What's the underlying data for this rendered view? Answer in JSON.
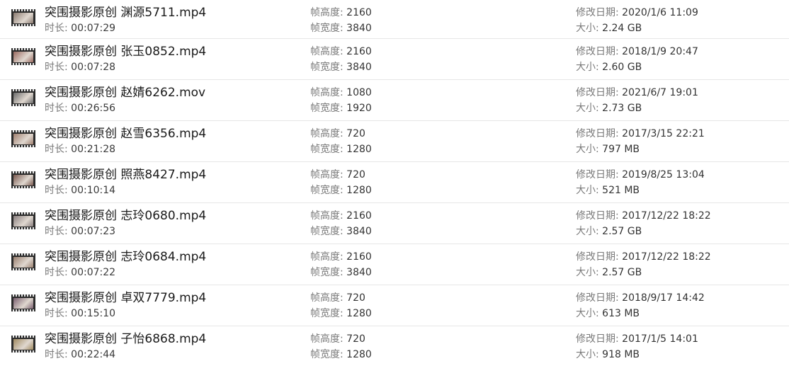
{
  "labels": {
    "duration": "时长:",
    "frame_height": "帧高度:",
    "frame_width": "帧宽度:",
    "modified": "修改日期:",
    "size": "大小:"
  },
  "files": [
    {
      "name": "突围摄影原创 渊源5711.mp4",
      "duration": "00:07:29",
      "frame_height": "2160",
      "frame_width": "3840",
      "modified": "2020/1/6 11:09",
      "size": "2.24 GB",
      "thumb_color": "#8a7a70"
    },
    {
      "name": "突围摄影原创 张玉0852.mp4",
      "duration": "00:07:28",
      "frame_height": "2160",
      "frame_width": "3840",
      "modified": "2018/1/9 20:47",
      "size": "2.60 GB",
      "thumb_color": "#9a6a60"
    },
    {
      "name": "突围摄影原创 赵婧6262.mov",
      "duration": "00:26:56",
      "frame_height": "1080",
      "frame_width": "1920",
      "modified": "2021/6/7 19:01",
      "size": "2.73 GB",
      "thumb_color": "#6a6a6a"
    },
    {
      "name": "突围摄影原创 赵雪6356.mp4",
      "duration": "00:21:28",
      "frame_height": "720",
      "frame_width": "1280",
      "modified": "2017/3/15 22:21",
      "size": "797 MB",
      "thumb_color": "#a08070"
    },
    {
      "name": "突围摄影原创 照燕8427.mp4",
      "duration": "00:10:14",
      "frame_height": "720",
      "frame_width": "1280",
      "modified": "2019/8/25 13:04",
      "size": "521 MB",
      "thumb_color": "#7a5a50"
    },
    {
      "name": "突围摄影原创 志玲0680.mp4",
      "duration": "00:07:23",
      "frame_height": "2160",
      "frame_width": "3840",
      "modified": "2017/12/22 18:22",
      "size": "2.57 GB",
      "thumb_color": "#8a8080"
    },
    {
      "name": "突围摄影原创 志玲0684.mp4",
      "duration": "00:07:22",
      "frame_height": "2160",
      "frame_width": "3840",
      "modified": "2017/12/22 18:22",
      "size": "2.57 GB",
      "thumb_color": "#9a8070"
    },
    {
      "name": "突围摄影原创 卓双7779.mp4",
      "duration": "00:15:10",
      "frame_height": "720",
      "frame_width": "1280",
      "modified": "2018/9/17 14:42",
      "size": "613 MB",
      "thumb_color": "#7a6070"
    },
    {
      "name": "突围摄影原创 子怡6868.mp4",
      "duration": "00:22:44",
      "frame_height": "720",
      "frame_width": "1280",
      "modified": "2017/1/5 14:01",
      "size": "918 MB",
      "thumb_color": "#a08a60"
    }
  ]
}
